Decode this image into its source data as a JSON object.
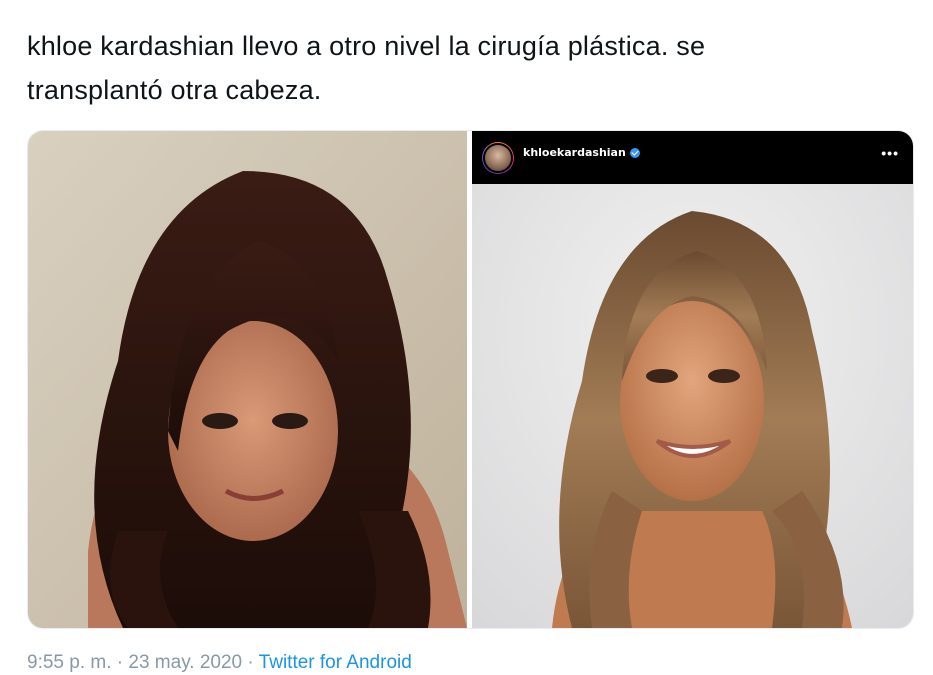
{
  "tweet": {
    "text_line1": "khloe kardashian llevo a otro nivel la cirugía plástica. se",
    "text_line2": "transplantó otra cabeza.",
    "time": "9:55 p. m.",
    "separator": " · ",
    "date": "23 may. 2020",
    "source": "Twitter for Android"
  },
  "instagram_header": {
    "username": "khloekardashian",
    "more_icon": "•••",
    "verified_color": "#3897f0"
  },
  "colors": {
    "text": "#0f1419",
    "meta": "#8899a6",
    "link": "#1b95e0"
  }
}
